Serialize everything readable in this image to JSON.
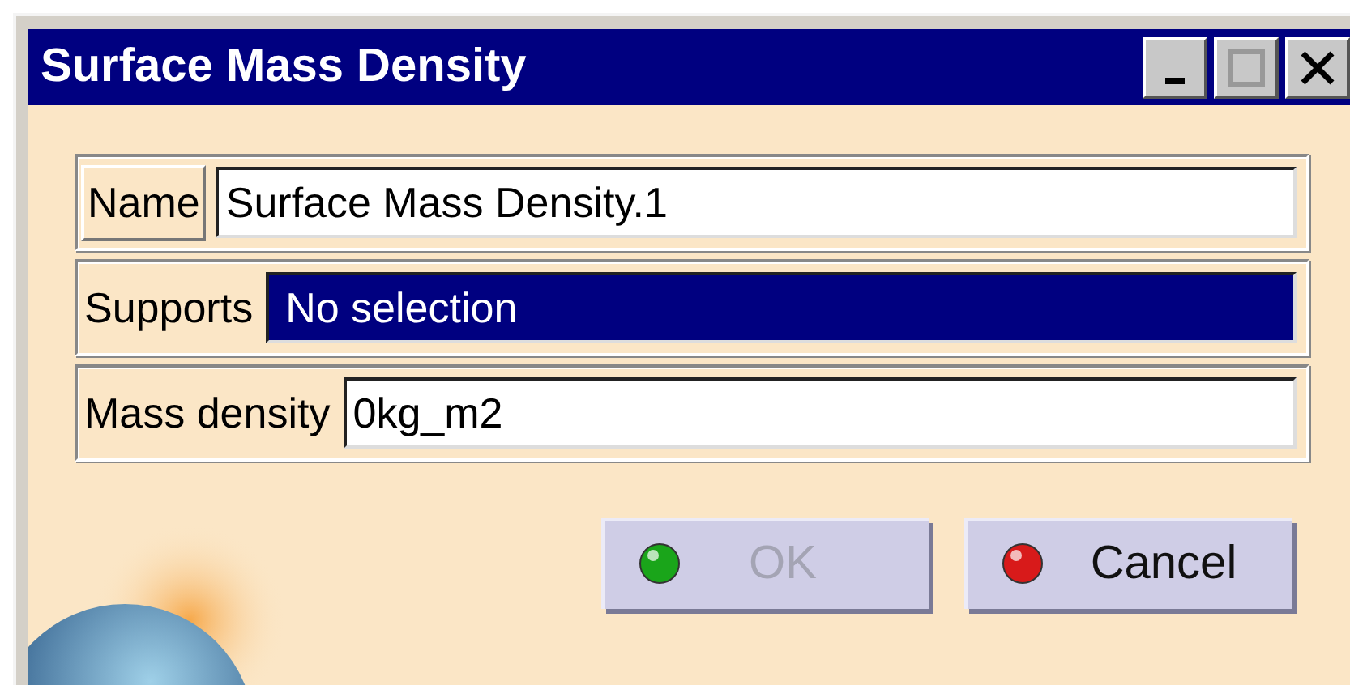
{
  "window": {
    "title": "Surface Mass Density"
  },
  "fields": [
    {
      "label": "Name",
      "value": "Surface Mass Density.1",
      "selected": false
    },
    {
      "label": "Supports",
      "value": "No selection",
      "selected": true
    },
    {
      "label": "Mass density",
      "value": "0kg_m2",
      "selected": false
    }
  ],
  "buttons": [
    {
      "label": "OK",
      "kind": "ok",
      "disabled": true
    },
    {
      "label": "Cancel",
      "kind": "cancel",
      "disabled": false
    }
  ]
}
